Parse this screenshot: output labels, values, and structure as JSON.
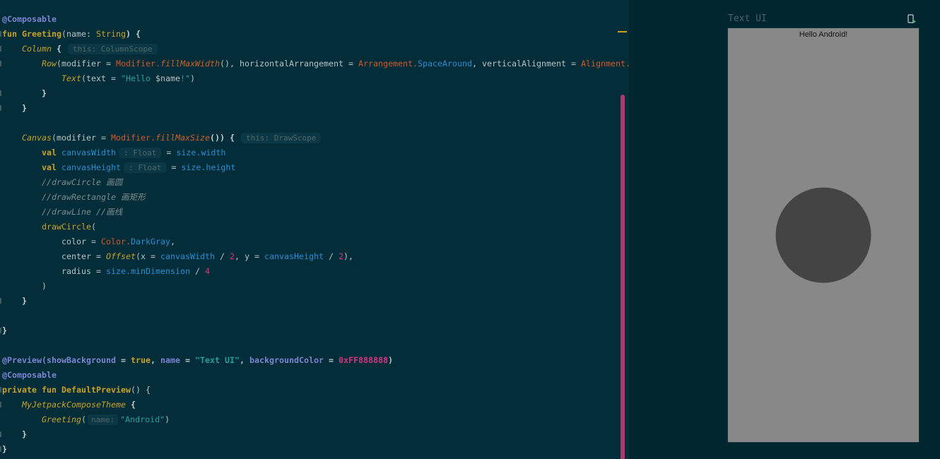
{
  "editor": {
    "lines": [
      [
        "@Composable"
      ],
      [
        "fun ",
        "Greeting",
        "(name: ",
        "String",
        ") {"
      ],
      [
        "Column",
        " {",
        "this: ColumnScope"
      ],
      [
        "Row",
        "(modifier = ",
        "Modifier.",
        "fillMaxWidth",
        "(), horizontalArrangement = ",
        "Arrangement.",
        "SpaceAround",
        ", verticalAlignment = ",
        "Alignment."
      ],
      [
        "Text",
        "(text = ",
        "\"Hello ",
        "$name",
        "!\"",
        ")"
      ],
      [
        "}"
      ],
      [
        "}"
      ],
      [],
      [
        "Canvas",
        "(modifier = ",
        "Modifier.",
        "fillMaxSize",
        "()) {",
        "this: DrawScope"
      ],
      [
        "val ",
        "canvasWidth",
        ": Float",
        " = ",
        "size.width"
      ],
      [
        "val ",
        "canvasHeight",
        ": Float",
        " = ",
        "size.height"
      ],
      [
        "//drawCircle 画圆"
      ],
      [
        "//drawRectangle 画矩形"
      ],
      [
        "//drawLine //画线"
      ],
      [
        "drawCircle",
        "("
      ],
      [
        "color = ",
        "Color.",
        "DarkGray",
        ","
      ],
      [
        "center = ",
        "Offset",
        "(x = ",
        "canvasWidth",
        " / ",
        "2",
        ", y = ",
        "canvasHeight",
        " / ",
        "2",
        "),"
      ],
      [
        "radius = ",
        "size.minDimension",
        " / ",
        "4"
      ],
      [
        ")"
      ],
      [
        "}"
      ],
      [],
      [
        "}"
      ],
      [],
      [
        "@Preview(",
        "showBackground",
        " = ",
        "true",
        ", ",
        "name",
        " = ",
        "\"Text UI\"",
        ", ",
        "backgroundColor",
        " = ",
        "0xFF888888",
        ")"
      ],
      [
        "@Composable"
      ],
      [
        "private fun ",
        "DefaultPreview",
        "() {"
      ],
      [
        "MyJetpackComposeTheme",
        " {"
      ],
      [
        "Greeting",
        "(",
        "name:",
        "\"Android\"",
        ")"
      ],
      [
        "}"
      ],
      [
        "}"
      ]
    ]
  },
  "preview": {
    "title": "Text UI",
    "greeting_text": "Hello Android!",
    "background_color": "#888888",
    "circle_color": "#444444"
  },
  "icons": {
    "deploy": "deploy-to-device-icon"
  }
}
